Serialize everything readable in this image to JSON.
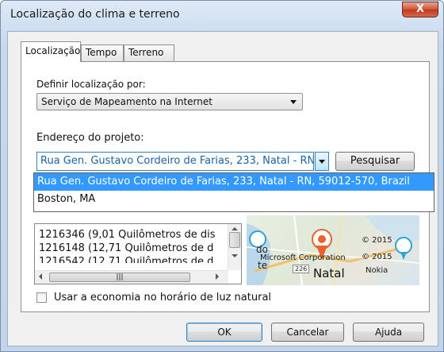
{
  "window": {
    "title": "Localização do clima e terreno",
    "close_label": "X"
  },
  "tabs": [
    {
      "label": "Localização",
      "active": true
    },
    {
      "label": "Tempo",
      "active": false
    },
    {
      "label": "Terreno",
      "active": false
    }
  ],
  "location_by": {
    "label": "Definir localização por:",
    "value": "Serviço de Mapeamento na Internet"
  },
  "address": {
    "label": "Endereço do projeto:",
    "value": "Rua Gen. Gustavo Cordeiro de Farias, 233, Natal - RN, 59012-570, Brazil",
    "search_label": "Pesquisar",
    "dropdown_options": [
      "Rua Gen. Gustavo Cordeiro de Farias, 233, Natal - RN, 59012-570, Brazil",
      "Boston, MA"
    ],
    "selected_option_index": 0
  },
  "stations": [
    "1216346 (9,01 Quilômetros de dis",
    "1216148 (12,71 Quilômetros de d",
    "1216542 (12,71 Quilômetros de d"
  ],
  "map": {
    "city": "Natal",
    "road_number": "226",
    "attribution_company": "Microsoft Corporation",
    "attribution_partner": "Nokia",
    "copyright_1": "© 2015",
    "copyright_2": "© 2015",
    "partial_label": "do",
    "partial_label_2": "te",
    "colors": {
      "marker": "#e8642c",
      "water": "#bcd7ea",
      "land": "#e4ecdc"
    }
  },
  "daylight_saving": {
    "label": "Usar a economia no horário de luz natural",
    "checked": false
  },
  "footer": {
    "ok_label": "OK",
    "cancel_label": "Cancelar",
    "help_label": "Ajuda"
  }
}
